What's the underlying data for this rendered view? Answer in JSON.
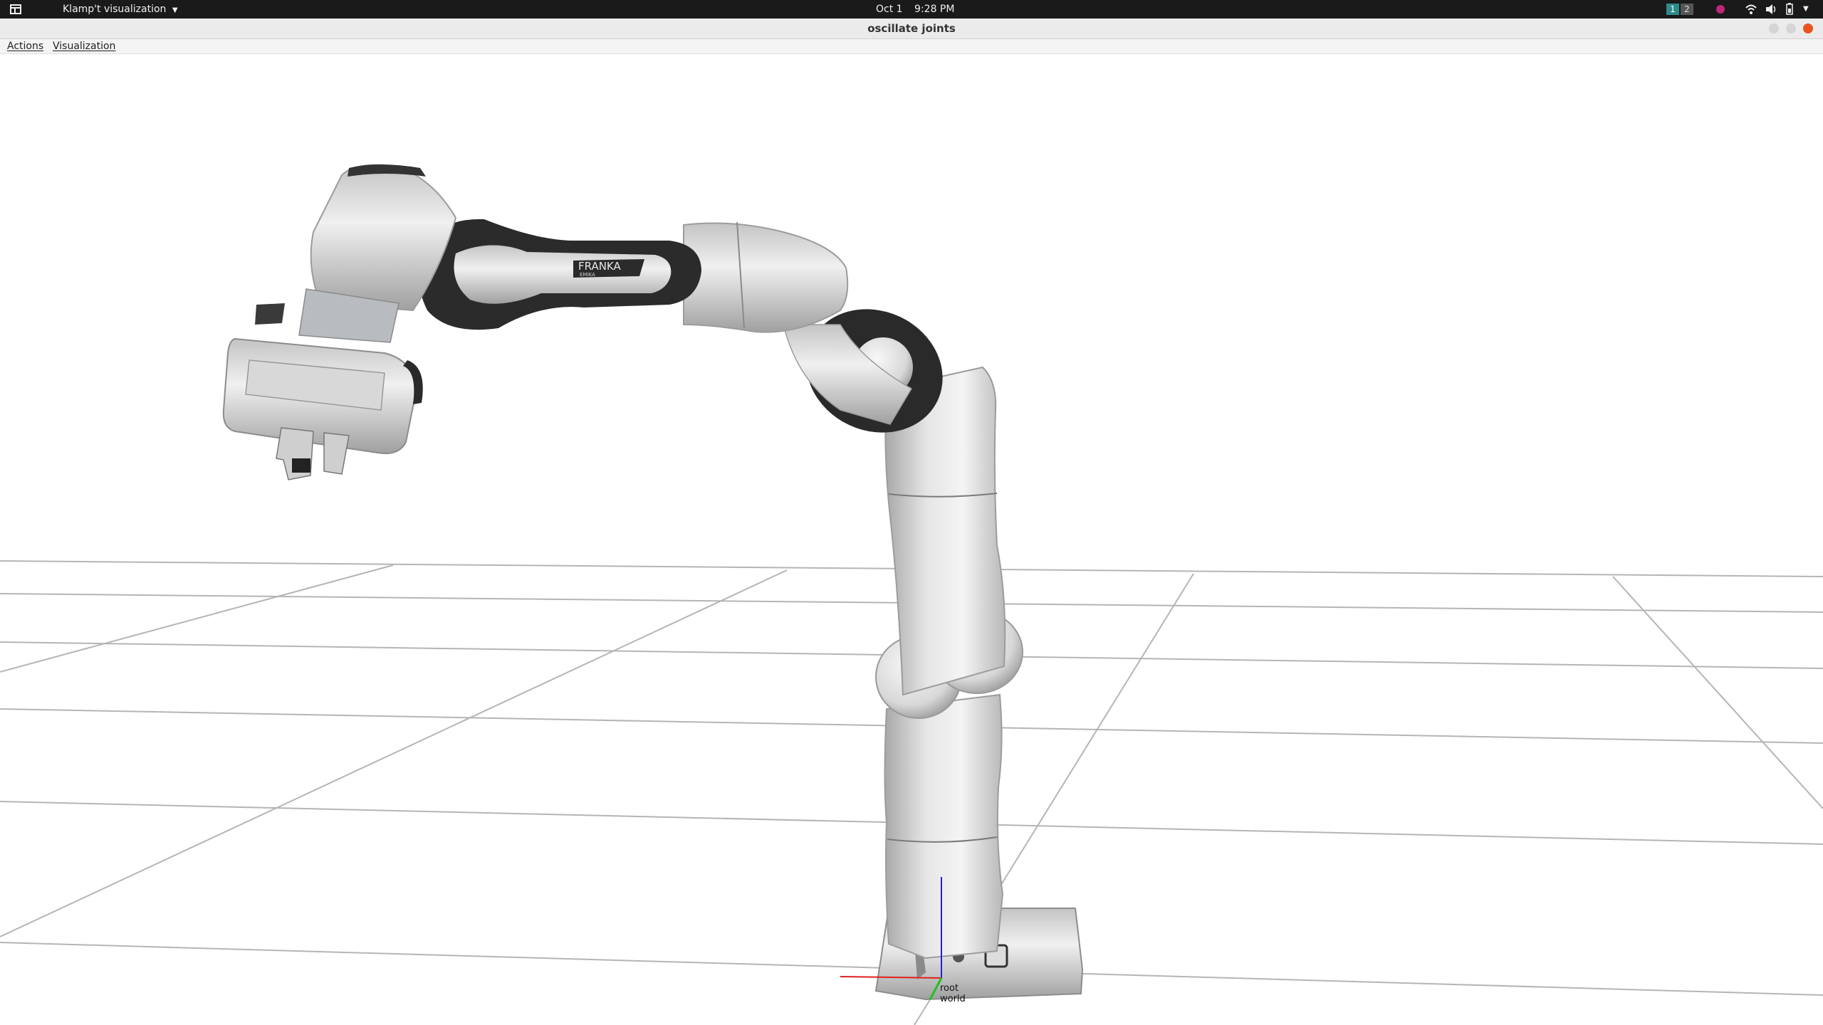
{
  "topbar": {
    "app_menu": "Klamp't visualization",
    "date": "Oct 1",
    "time": "9:28 PM",
    "workspaces": [
      "1",
      "2"
    ]
  },
  "window": {
    "title": "oscillate joints"
  },
  "menubar": {
    "items": [
      "Actions",
      "Visualization"
    ]
  },
  "scene": {
    "robot_logo": "FRANKA",
    "robot_logo_sub": "EMIKA",
    "frame_label_1": "root",
    "frame_label_2": "world"
  },
  "colors": {
    "topbar_bg": "#1a1a1a",
    "close_button": "#e95420",
    "workspace_active": "#2e8b8b",
    "axis_x": "#e02020",
    "axis_y": "#20c020",
    "axis_z": "#2020e0"
  }
}
